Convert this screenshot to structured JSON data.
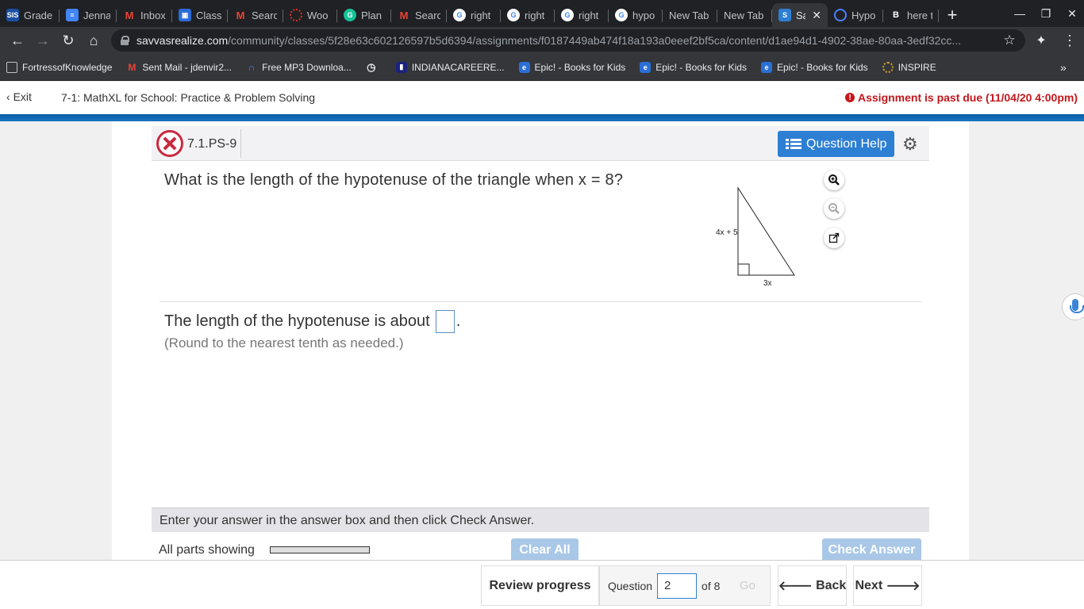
{
  "browser": {
    "tabs": [
      {
        "label": "Grade",
        "icon": "sis-icon",
        "color": "#1a4fa3"
      },
      {
        "label": "Jenna",
        "icon": "docs-icon",
        "color": "#4285f4"
      },
      {
        "label": "Inbox",
        "icon": "gmail-icon",
        "color": "#ea4335"
      },
      {
        "label": "Class",
        "icon": "classroom-icon",
        "color": "#1e8e3e"
      },
      {
        "label": "Searc",
        "icon": "gmail-icon",
        "color": "#ea4335"
      },
      {
        "label": "Woo",
        "icon": "wooclap-icon",
        "color": "#d93025"
      },
      {
        "label": "Plan",
        "icon": "grammarly-icon",
        "color": "#15c39a"
      },
      {
        "label": "Searc",
        "icon": "gmail-icon",
        "color": "#ea4335"
      },
      {
        "label": "right",
        "icon": "google-icon",
        "color": "#ffffff"
      },
      {
        "label": "right",
        "icon": "google-icon",
        "color": "#ffffff"
      },
      {
        "label": "right",
        "icon": "google-icon",
        "color": "#ffffff"
      },
      {
        "label": "hypo",
        "icon": "google-icon",
        "color": "#ffffff"
      },
      {
        "label": "New Tab",
        "icon": "",
        "color": ""
      },
      {
        "label": "New Tab",
        "icon": "",
        "color": ""
      },
      {
        "label": "Sa",
        "icon": "savvas-icon",
        "color": "#2d7fd4",
        "active": true
      },
      {
        "label": "Hypo",
        "icon": "hypo-icon",
        "color": "#4d7fff"
      },
      {
        "label": "here t",
        "icon": "brainly-icon",
        "color": "#202124"
      }
    ],
    "url_host": "savvasrealize.com",
    "url_path": "/community/classes/5f28e63c602126597b5d6394/assignments/f0187449ab474f18a193a0eeef2bf5ca/content/d1ae94d1-4902-38ae-80aa-3edf32cc...",
    "bookmarks": [
      {
        "label": "FortressofKnowledge",
        "icon": "folder-icon"
      },
      {
        "label": "Sent Mail - jdenvir2...",
        "icon": "gmail-icon"
      },
      {
        "label": "Free MP3 Downloa...",
        "icon": "headphones-icon"
      },
      {
        "label": "",
        "icon": "history-icon"
      },
      {
        "label": "INDIANACAREERE...",
        "icon": "indiana-icon"
      },
      {
        "label": "Epic! - Books for Kids",
        "icon": "epic-icon"
      },
      {
        "label": "Epic! - Books for Kids",
        "icon": "epic-icon"
      },
      {
        "label": "Epic! - Books for Kids",
        "icon": "epic-icon"
      },
      {
        "label": "INSPIRE",
        "icon": "inspire-icon"
      }
    ]
  },
  "app": {
    "exit_label": "Exit",
    "title": "7-1: MathXL for School: Practice & Problem Solving",
    "past_due": "Assignment is past due (11/04/20 4:00pm)"
  },
  "question": {
    "id": "7.1.PS-9",
    "help_label": "Question Help",
    "prompt": "What is the length of the hypotenuse of the triangle when x = 8?",
    "figure": {
      "leg_vertical_label": "4x + 5",
      "leg_horizontal_label": "3x"
    },
    "answer_prefix": "The length of the hypotenuse is about",
    "answer_suffix": ".",
    "answer_value": "",
    "round_note": "(Round to the nearest tenth as needed.)"
  },
  "controls": {
    "instructions": "Enter your answer in the answer box and then click Check Answer.",
    "all_parts": "All parts showing",
    "clear_all": "Clear All",
    "check_answer": "Check Answer"
  },
  "footer": {
    "review_progress": "Review progress",
    "question_label": "Question",
    "question_number": "2",
    "of_label": "of 8",
    "go_label": "Go",
    "back_label": "Back",
    "next_label": "Next"
  }
}
